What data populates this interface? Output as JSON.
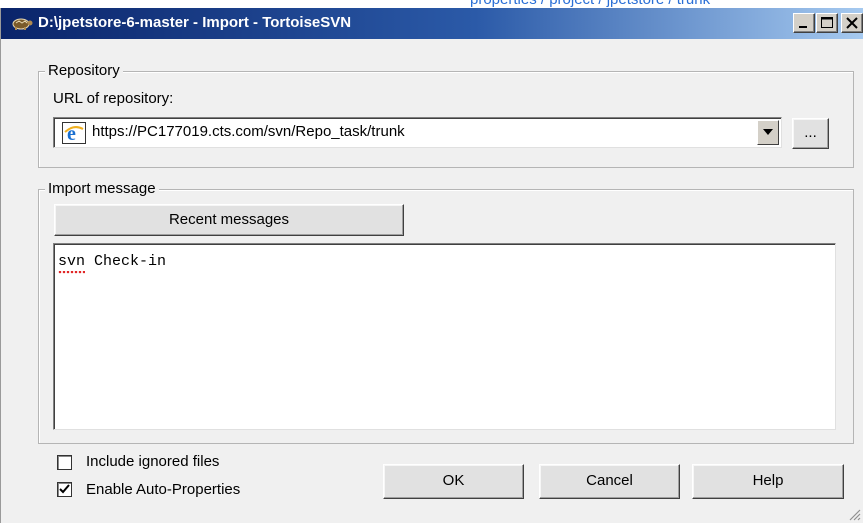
{
  "background": {
    "link_text": "properties / project / jpetstore / trunk"
  },
  "window": {
    "title": "D:\\jpetstore-6-master - Import - TortoiseSVN",
    "controls": [
      "minimize",
      "maximize",
      "close"
    ]
  },
  "repository": {
    "group_label": "Repository",
    "url_label": "URL of repository:",
    "url_value": "https://PC177019.cts.com/svn/Repo_task/trunk",
    "browse_label": "..."
  },
  "import_message": {
    "group_label": "Import message",
    "recent_button": "Recent messages",
    "message_text": "svn Check-in"
  },
  "options": {
    "include_ignored": {
      "label": "Include ignored files",
      "checked": false
    },
    "auto_properties": {
      "label": "Enable Auto-Properties",
      "checked": true
    }
  },
  "buttons": {
    "ok": "OK",
    "cancel": "Cancel",
    "help": "Help"
  },
  "colors": {
    "title_gradient_start": "#0a246a",
    "title_gradient_end": "#a6caf0",
    "dialog_bg": "#f0f0f0",
    "spellcheck": "#e02020"
  }
}
